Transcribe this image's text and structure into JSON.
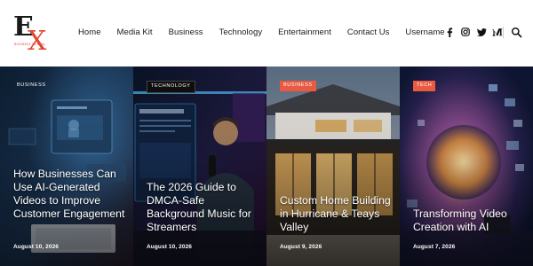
{
  "brand": {
    "logo_letters": "EX",
    "logo_tagline": "BUSINESS MENTAL",
    "accent_color": "#e0472f"
  },
  "nav": {
    "items": [
      "Home",
      "Media Kit",
      "Business",
      "Technology",
      "Entertainment",
      "Contact Us",
      "Username"
    ]
  },
  "social": {
    "icons": [
      "facebook-icon",
      "instagram-icon",
      "twitter-icon",
      "medium-icon"
    ]
  },
  "search": {
    "icon": "search-icon"
  },
  "cards": [
    {
      "category": "BUSINESS",
      "category_color": "#ea5a40",
      "title": "How Businesses Can Use AI-Generated Videos to Improve Customer Engagement",
      "date": "August 10, 2026"
    },
    {
      "category": "TECHNOLOGY",
      "category_color": "#0e0e0e",
      "title": "The 2026 Guide to DMCA-Safe Background Music for Streamers",
      "date": "August 10, 2026"
    },
    {
      "category": "BUSINESS",
      "category_color": "#ea5a40",
      "title": "Custom Home Building in Hurricane & Teays Valley",
      "date": "August 9, 2026"
    },
    {
      "category": "TECH",
      "category_color": "#ea5a40",
      "title": "Transforming Video Creation with AI",
      "date": "August 7, 2026"
    }
  ]
}
